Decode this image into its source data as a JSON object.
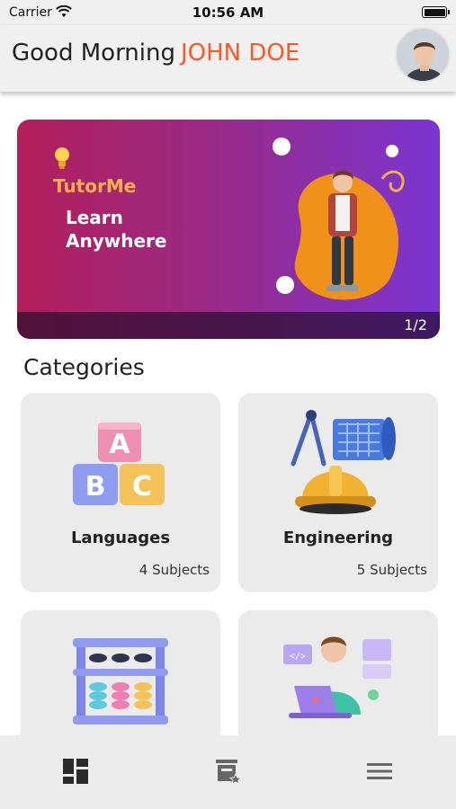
{
  "status_bar": {
    "carrier": "Carrier",
    "time": "10:56 AM"
  },
  "header": {
    "greeting": "Good Morning",
    "user_name": "JOHN DOE",
    "accent_color": "#ff5722"
  },
  "banner": {
    "brand": "TutorMe",
    "tagline": "Learn Anywhere",
    "pager": "1/2"
  },
  "categories": {
    "title": "Categories",
    "items": [
      {
        "label": "Languages",
        "count": "4 Subjects",
        "icon": "abc-blocks-icon"
      },
      {
        "label": "Engineering",
        "count": "5 Subjects",
        "icon": "engineering-helmet-icon"
      },
      {
        "label": "",
        "count": "",
        "icon": "abacus-icon"
      },
      {
        "label": "",
        "count": "",
        "icon": "programmer-laptop-icon"
      }
    ]
  },
  "bottom_nav": {
    "items": [
      "dashboard-icon",
      "bookmark-star-icon",
      "menu-icon"
    ]
  }
}
